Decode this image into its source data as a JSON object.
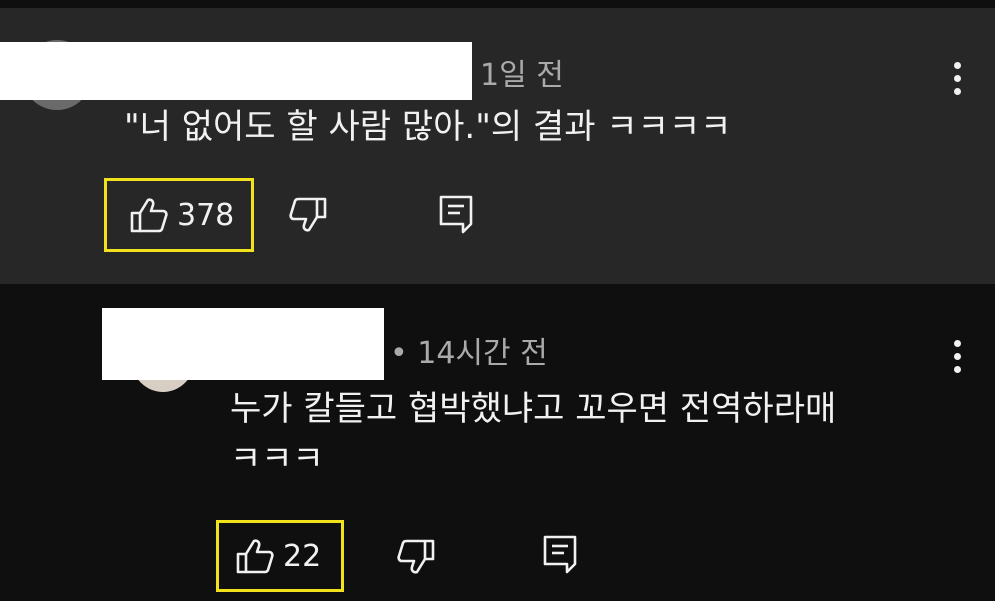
{
  "comments": [
    {
      "time": "1일 전",
      "text": "\"너 없어도 할 사람 많아.\"의 결과 ㅋㅋㅋㅋ",
      "likes": "378"
    },
    {
      "time": "• 14시간 전",
      "text_line1": "누가 칼들고 협박했냐고 꼬우면 전역하라매",
      "text_line2": "ㅋㅋㅋ",
      "likes": "22"
    }
  ],
  "colors": {
    "highlight": "#f2e21d",
    "card_bg": "#272727",
    "page_bg": "#0f0f0f",
    "meta_text": "#aaaaaa"
  },
  "icons": [
    "thumbs-up-icon",
    "thumbs-down-icon",
    "reply-icon",
    "more-vert-icon"
  ]
}
